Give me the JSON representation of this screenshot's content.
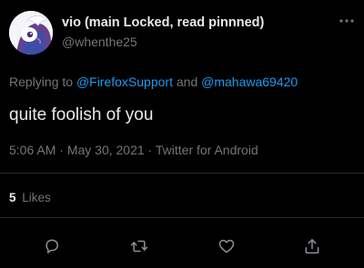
{
  "author": {
    "display_name": "vio (main Locked, read pinnned)",
    "handle": "@whenthe25"
  },
  "reply_context": {
    "prefix": "Replying to ",
    "mentions": [
      "@FirefoxSupport",
      "@mahawa69420"
    ],
    "joiner": " and "
  },
  "tweet": {
    "text": "quite foolish of you"
  },
  "meta": {
    "time": "5:06 AM",
    "separator": " · ",
    "date": "May 30, 2021",
    "source": "Twitter for Android"
  },
  "stats": {
    "likes_count": "5",
    "likes_label": "Likes"
  },
  "icons": {
    "avatar": "profile-avatar",
    "more": "more-options-icon",
    "reply": "reply-icon",
    "retweet": "retweet-icon",
    "like": "like-icon",
    "share": "share-icon"
  },
  "colors": {
    "background": "#000000",
    "text_primary": "#e7e9ea",
    "text_secondary": "#71767b",
    "link": "#1d9bf0"
  }
}
